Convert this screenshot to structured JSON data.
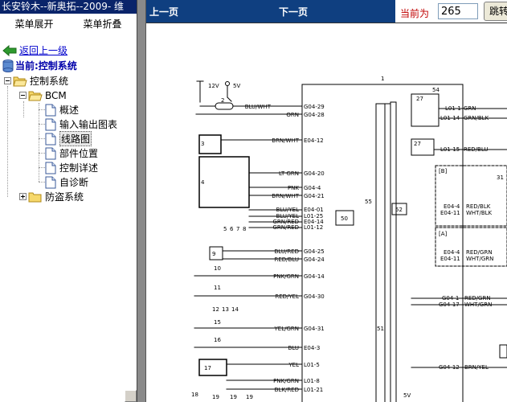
{
  "window": {
    "title": "长安铃木--新奥拓--2009- 维"
  },
  "menu": {
    "expand_label": "菜单展开",
    "collapse_label": "菜单折叠"
  },
  "back_label": "返回上一级",
  "current_label": "当前:控制系统",
  "tree": {
    "root": "控制系统",
    "bcm": "BCM",
    "children": [
      "概述",
      "输入输出图表",
      "线路图",
      "部件位置",
      "控制详述",
      "自诊断"
    ],
    "selected_index": 2,
    "anti_theft": "防盗系统"
  },
  "nav": {
    "prev_label": "上一页",
    "next_label": "下一页",
    "current_label": "当前为",
    "page_value": "265",
    "jump_label": "跳转"
  },
  "diagram": {
    "top_labels": {
      "v12": "12V",
      "v5": "5V",
      "module_num": "1",
      "n54": "54",
      "n55": "55",
      "n51": "51",
      "n52": "52",
      "n50": "50",
      "n5v_bottom": "5V",
      "n31": "31"
    },
    "left_components": [
      "2",
      "3",
      "4",
      "5",
      "6",
      "7",
      "8",
      "9",
      "10",
      "11",
      "12",
      "13",
      "14",
      "15",
      "16",
      "17",
      "18",
      "19",
      "19",
      "19"
    ],
    "left_wires": [
      {
        "color": "BLU/WHT",
        "pin": "G04-29"
      },
      {
        "color": "ORN",
        "pin": "G04-28"
      },
      {
        "color": "BRN/WHT",
        "pin": "E04-12"
      },
      {
        "color": "LT GRN",
        "pin": "G04-20"
      },
      {
        "color": "PNK",
        "pin": "G04-4"
      },
      {
        "color": "BRN/WHT",
        "pin": "G04-21"
      },
      {
        "color": "BLU/YEL",
        "pin": "E04-01"
      },
      {
        "color": "BLU/YEL",
        "pin": "L01-25"
      },
      {
        "color": "GRN/RED",
        "pin": "E04-14"
      },
      {
        "color": "GRN/RED",
        "pin": "L01-12"
      },
      {
        "color": "BLU/RED",
        "pin": "G04-25"
      },
      {
        "color": "RED/BLU",
        "pin": "G04-24"
      },
      {
        "color": "PNK/GRN",
        "pin": "G04-14"
      },
      {
        "color": "RED/YEL",
        "pin": "G04-30"
      },
      {
        "color": "YEL/GRN",
        "pin": "G04-31"
      },
      {
        "color": "BLU",
        "pin": "E04-3"
      },
      {
        "color": "YEL",
        "pin": "L01-5"
      },
      {
        "color": "PNK/GRN",
        "pin": "L01-8"
      },
      {
        "color": "BLK/RED",
        "pin": "L01-21"
      }
    ],
    "right_wires": [
      {
        "pin": "L01-1",
        "color": "GRN"
      },
      {
        "pin": "L01-14",
        "color": "GRN/BLK"
      },
      {
        "pin": "L01-15",
        "color": "RED/BLU"
      },
      {
        "pin": "E04-4",
        "color": "RED/BLK"
      },
      {
        "pin": "E04-11",
        "color": "WHT/BLK"
      },
      {
        "pin": "E04-4",
        "color": "RED/GRN"
      },
      {
        "pin": "E04-11",
        "color": "WHT/GRN"
      },
      {
        "pin": "G04-1",
        "color": "RED/GRN"
      },
      {
        "pin": "G04-17",
        "color": "WHT/GRN"
      },
      {
        "pin": "G04-12",
        "color": "BRN/YEL"
      }
    ],
    "relays": [
      "27",
      "27",
      "27"
    ],
    "boxes": [
      "[B]",
      "[A]"
    ],
    "bottom_wires": [
      "PNK/GRN",
      "BLK/RED"
    ]
  }
}
